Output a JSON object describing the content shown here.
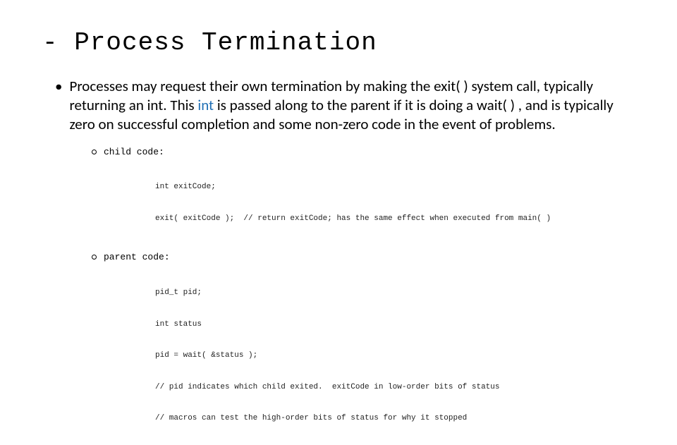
{
  "title": "- Process Termination",
  "bullet": {
    "marker": "•",
    "text_before": "Processes may request their own termination by making the exit( ) system call, typically returning an int. This ",
    "link_text": "int",
    "text_after": " is passed along to the parent if it is doing a wait( ) , and is typically zero on successful completion and some non-zero code in the event of problems."
  },
  "code_sections": [
    {
      "label": "child code:",
      "lines": [
        "int exitCode;",
        "exit( exitCode );  // return exitCode; has the same effect when executed from main( )"
      ]
    },
    {
      "label": "parent code:",
      "lines": [
        "pid_t pid;",
        "int status",
        "pid = wait( &status );",
        "// pid indicates which child exited.  exitCode in low-order bits of status",
        "// macros can test the high-order bits of status for why it stopped"
      ]
    }
  ]
}
